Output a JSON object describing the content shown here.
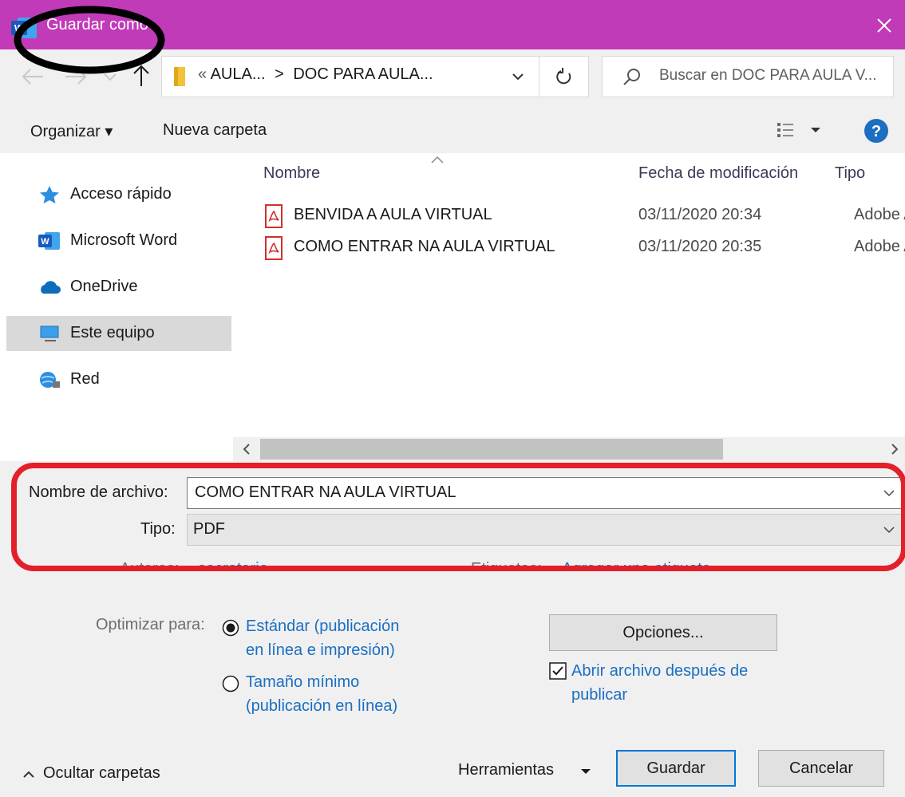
{
  "window": {
    "title": "Guardar como",
    "titlebar_color": "#c13ab8"
  },
  "navigation": {
    "address_parts": [
      "«",
      "AULA...",
      ">",
      "DOC PARA AULA..."
    ],
    "search_placeholder": "Buscar en DOC PARA AULA V..."
  },
  "toolbar": {
    "organize_label": "Organizar ▾",
    "new_folder_label": "Nueva carpeta"
  },
  "sidebar": {
    "items": [
      {
        "label": "Acceso rápido",
        "icon": "star-icon"
      },
      {
        "label": "Microsoft Word",
        "icon": "word-icon"
      },
      {
        "label": "OneDrive",
        "icon": "cloud-icon"
      },
      {
        "label": "Este equipo",
        "icon": "computer-icon",
        "selected": true
      },
      {
        "label": "Red",
        "icon": "network-icon"
      }
    ]
  },
  "file_list": {
    "columns": [
      "Nombre",
      "Fecha de modificación",
      "Tipo"
    ],
    "rows": [
      {
        "name": "BENVIDA A AULA VIRTUAL",
        "date": "03/11/2020 20:34",
        "type": "Adobe A"
      },
      {
        "name": "COMO ENTRAR NA AULA VIRTUAL",
        "date": "03/11/2020 20:35",
        "type": "Adobe A"
      }
    ]
  },
  "form": {
    "filename_label": "Nombre de archivo:",
    "filename_value": "COMO ENTRAR NA AULA VIRTUAL",
    "type_label": "Tipo:",
    "type_value": "PDF",
    "authors_label": "Autores:",
    "authors_value": "secretario",
    "tags_label": "Etiquetas:",
    "tags_value": "Agregar una etiqueta"
  },
  "options": {
    "optimize_label": "Optimizar para:",
    "standard_line1": "Estándar (publicación",
    "standard_line2": "en línea e impresión)",
    "minimum_line1": "Tamaño mínimo",
    "minimum_line2": "(publicación en línea)",
    "options_button": "Opciones...",
    "open_after_line1": "Abrir archivo después de",
    "open_after_line2": "publicar",
    "open_after_checked": true
  },
  "footer": {
    "hide_folders": "Ocultar carpetas",
    "tools": "Herramientas",
    "save": "Guardar",
    "cancel": "Cancelar"
  },
  "annotations": {
    "red_box_color": "#e3202a",
    "black_circle_color": "#000000"
  }
}
